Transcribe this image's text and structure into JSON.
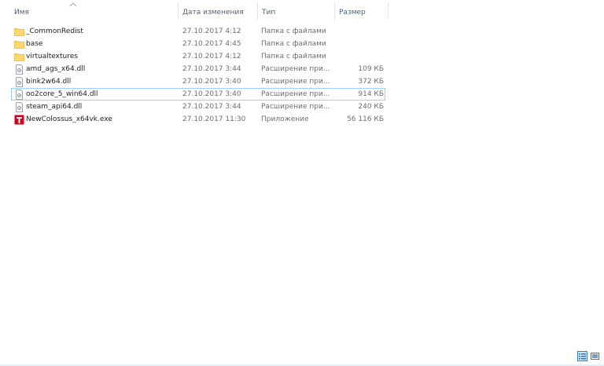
{
  "columns": {
    "name": "Имя",
    "date": "Дата изменения",
    "type": "Тип",
    "size": "Размер"
  },
  "sort": {
    "column": "name",
    "direction": "ascending",
    "icon": "chevron-up-icon"
  },
  "files": [
    {
      "name": "_CommonRedist",
      "date": "27.10.2017 4:12",
      "type": "Папка с файлами",
      "size": "",
      "icon": "folder-icon"
    },
    {
      "name": "base",
      "date": "27.10.2017 4:45",
      "type": "Папка с файлами",
      "size": "",
      "icon": "folder-icon"
    },
    {
      "name": "virtualtextures",
      "date": "27.10.2017 4:12",
      "type": "Папка с файлами",
      "size": "",
      "icon": "folder-icon"
    },
    {
      "name": "amd_ags_x64.dll",
      "date": "27.10.2017 3:44",
      "type": "Расширение при...",
      "size": "109 КБ",
      "icon": "dll-file-icon"
    },
    {
      "name": "bink2w64.dll",
      "date": "27.10.2017 3:40",
      "type": "Расширение при...",
      "size": "372 КБ",
      "icon": "dll-file-icon"
    },
    {
      "name": "oo2core_5_win64.dll",
      "date": "27.10.2017 3:40",
      "type": "Расширение при...",
      "size": "914 КБ",
      "icon": "dll-file-icon"
    },
    {
      "name": "steam_api64.dll",
      "date": "27.10.2017 3:44",
      "type": "Расширение при...",
      "size": "240 КБ",
      "icon": "dll-file-icon"
    },
    {
      "name": "NewColossus_x64vk.exe",
      "date": "27.10.2017 11:30",
      "type": "Приложение",
      "size": "56 116 КБ",
      "icon": "game-exe-icon"
    }
  ],
  "focused_row": "oo2core_5_win64.dll",
  "view_buttons": {
    "details": "details-view-icon",
    "tiles": "large-icons-view-icon",
    "active": "details"
  },
  "colors": {
    "header_text": "#4c607a",
    "secondary_text": "#6d6d6d",
    "folder": "#ffd96a",
    "focus_border": "#99d1ff",
    "exe_icon": "#d0021b"
  }
}
